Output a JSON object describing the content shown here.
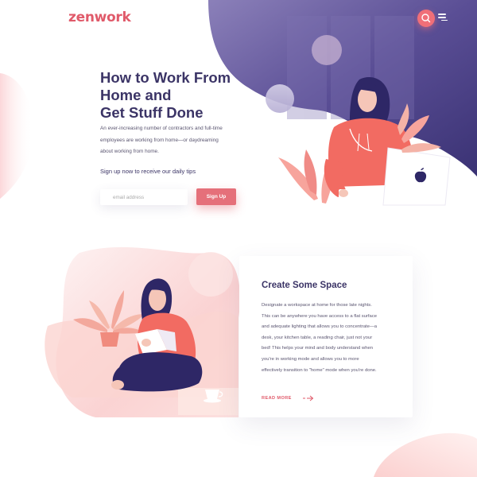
{
  "brand": {
    "logo": "zenwork",
    "accent_color": "#e05a6a",
    "dark_color": "#3b3466",
    "purple_color": "#4a3f85"
  },
  "header": {
    "search_icon": "search-icon",
    "menu_icon": "hamburger-menu-icon"
  },
  "hero": {
    "title_lines": [
      "How to Work From",
      "Home and",
      "Get Stuff Done"
    ],
    "description_lines": [
      "An ever-increasing number of contractors and full-time",
      "employees are working from home—or daydreaming",
      "about working from home."
    ],
    "signup_prompt": "Sign up now to receive our daily tips",
    "email_placeholder": "email address",
    "signup_button": "Sign Up"
  },
  "section2": {
    "title": "Create Some Space",
    "body_lines": [
      "Designate a workspace at home for those late nights.",
      "This can be anywhere you have access to a flat surface",
      "and adequate lighting that allows you to concentrate—a",
      "desk, your kitchen table, a reading chair, just not your",
      "bed! This helps your mind and body understand when",
      "you're in working mode and allows you to more",
      "effectively transition to \"home\" mode when you're done."
    ],
    "read_more": "READ MORE",
    "read_more_icon": "arrow-right-icon"
  }
}
